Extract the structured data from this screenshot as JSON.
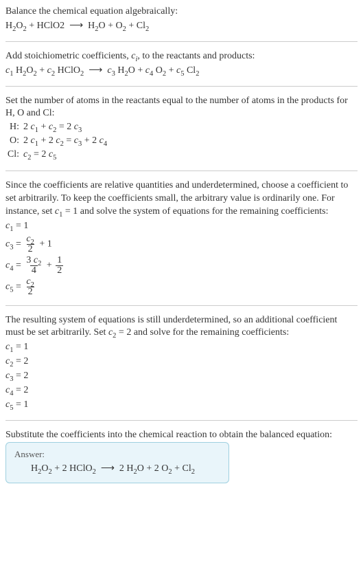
{
  "s1": {
    "intro": "Balance the chemical equation algebraically:",
    "eq_html": "H<sub>2</sub>O<sub>2</sub> + HClO2 &nbsp;⟶&nbsp; H<sub>2</sub>O + O<sub>2</sub> + Cl<sub>2</sub>"
  },
  "s2": {
    "intro_html": "Add stoichiometric coefficients, <span class=\"sub-i\">c<sub>i</sub></span>, to the reactants and products:",
    "eq_html": "<span class=\"sub-i\">c</span><sub>1</sub> H<sub>2</sub>O<sub>2</sub> + <span class=\"sub-i\">c</span><sub>2</sub> HClO<sub>2</sub> &nbsp;⟶&nbsp; <span class=\"sub-i\">c</span><sub>3</sub> H<sub>2</sub>O + <span class=\"sub-i\">c</span><sub>4</sub> O<sub>2</sub> + <span class=\"sub-i\">c</span><sub>5</sub> Cl<sub>2</sub>"
  },
  "s3": {
    "intro": "Set the number of atoms in the reactants equal to the number of atoms in the products for H, O and Cl:",
    "rows": [
      {
        "lbl": "H:",
        "eq_html": "2 <span class=\"sub-i\">c</span><sub>1</sub> + <span class=\"sub-i\">c</span><sub>2</sub> = 2 <span class=\"sub-i\">c</span><sub>3</sub>"
      },
      {
        "lbl": "O:",
        "eq_html": "2 <span class=\"sub-i\">c</span><sub>1</sub> + 2 <span class=\"sub-i\">c</span><sub>2</sub> = <span class=\"sub-i\">c</span><sub>3</sub> + 2 <span class=\"sub-i\">c</span><sub>4</sub>"
      },
      {
        "lbl": "Cl:",
        "eq_html": "<span class=\"sub-i\">c</span><sub>2</sub> = 2 <span class=\"sub-i\">c</span><sub>5</sub>"
      }
    ]
  },
  "s4": {
    "intro_html": "Since the coefficients are relative quantities and underdetermined, choose a coefficient to set arbitrarily. To keep the coefficients small, the arbitrary value is ordinarily one. For instance, set <span class=\"sub-i\">c</span><sub>1</sub> = 1 and solve the system of equations for the remaining coefficients:",
    "lines": [
      "<span class=\"sub-i\">c</span><sub>1</sub> = 1",
      "<span class=\"sub-i\">c</span><sub>3</sub> = <span class=\"frac\"><span class=\"num\"><span class=\"sub-i\">c</span><sub>2</sub></span><span class=\"den\">2</span></span> + 1",
      "<span class=\"sub-i\">c</span><sub>4</sub> = <span class=\"frac\"><span class=\"num\">3 <span class=\"sub-i\">c</span><sub>2</sub></span><span class=\"den\">4</span></span> + <span class=\"frac\"><span class=\"num\">1</span><span class=\"den\">2</span></span>",
      "<span class=\"sub-i\">c</span><sub>5</sub> = <span class=\"frac\"><span class=\"num\"><span class=\"sub-i\">c</span><sub>2</sub></span><span class=\"den\">2</span></span>"
    ]
  },
  "s5": {
    "intro_html": "The resulting system of equations is still underdetermined, so an additional coefficient must be set arbitrarily. Set <span class=\"sub-i\">c</span><sub>2</sub> = 2 and solve for the remaining coefficients:",
    "lines": [
      "<span class=\"sub-i\">c</span><sub>1</sub> = 1",
      "<span class=\"sub-i\">c</span><sub>2</sub> = 2",
      "<span class=\"sub-i\">c</span><sub>3</sub> = 2",
      "<span class=\"sub-i\">c</span><sub>4</sub> = 2",
      "<span class=\"sub-i\">c</span><sub>5</sub> = 1"
    ]
  },
  "s6": {
    "intro": "Substitute the coefficients into the chemical reaction to obtain the balanced equation:"
  },
  "answer": {
    "label": "Answer:",
    "eq_html": "H<sub>2</sub>O<sub>2</sub> + 2 HClO<sub>2</sub> &nbsp;⟶&nbsp; 2 H<sub>2</sub>O + 2 O<sub>2</sub> + Cl<sub>2</sub>"
  }
}
